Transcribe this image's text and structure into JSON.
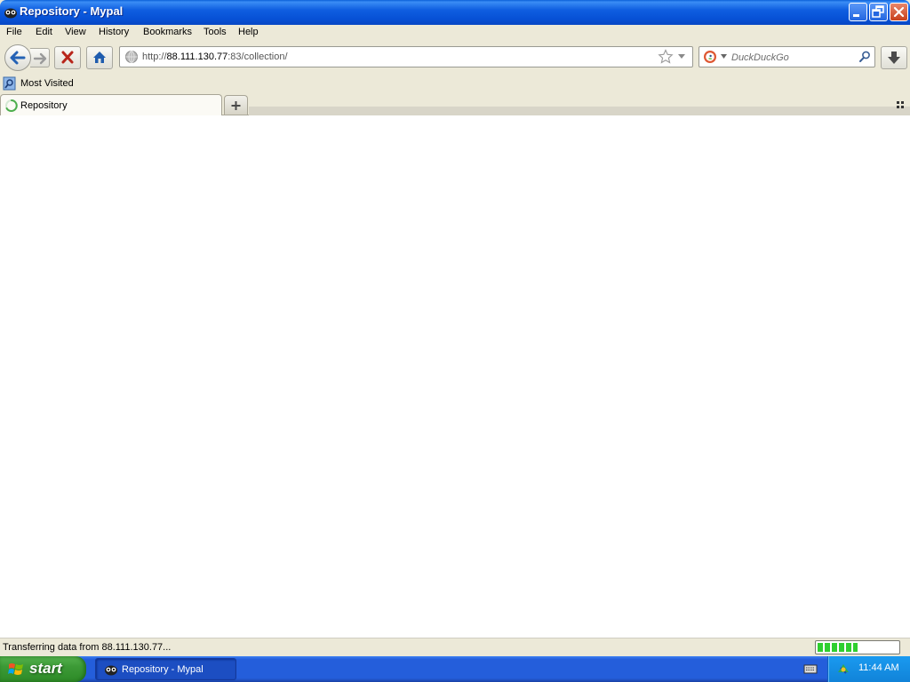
{
  "window": {
    "title": "Repository - Mypal"
  },
  "menu": {
    "items": [
      {
        "label": "File"
      },
      {
        "label": "Edit"
      },
      {
        "label": "View"
      },
      {
        "label": "History"
      },
      {
        "label": "Bookmarks"
      },
      {
        "label": "Tools"
      },
      {
        "label": "Help"
      }
    ]
  },
  "navbar": {
    "url_prefix": "http://",
    "url_host": "88.111.130.77",
    "url_rest": ":83/collection/",
    "search_placeholder": "DuckDuckGo"
  },
  "bookmarks": {
    "items": [
      {
        "label": "Most Visited",
        "icon": "most-visited-icon"
      }
    ]
  },
  "tabs": [
    {
      "label": "Repository",
      "loading": true
    }
  ],
  "status": {
    "text": "Transferring data from 88.111.130.77...",
    "progress_percent": 50
  },
  "taskbar": {
    "start_label": "start",
    "tasks": [
      {
        "label": "Repository - Mypal"
      }
    ],
    "clock": "11:44 AM"
  },
  "colors": {
    "titlebar": "#0751d6",
    "start_button": "#3c9a36",
    "progress": "#2fcf2f"
  }
}
